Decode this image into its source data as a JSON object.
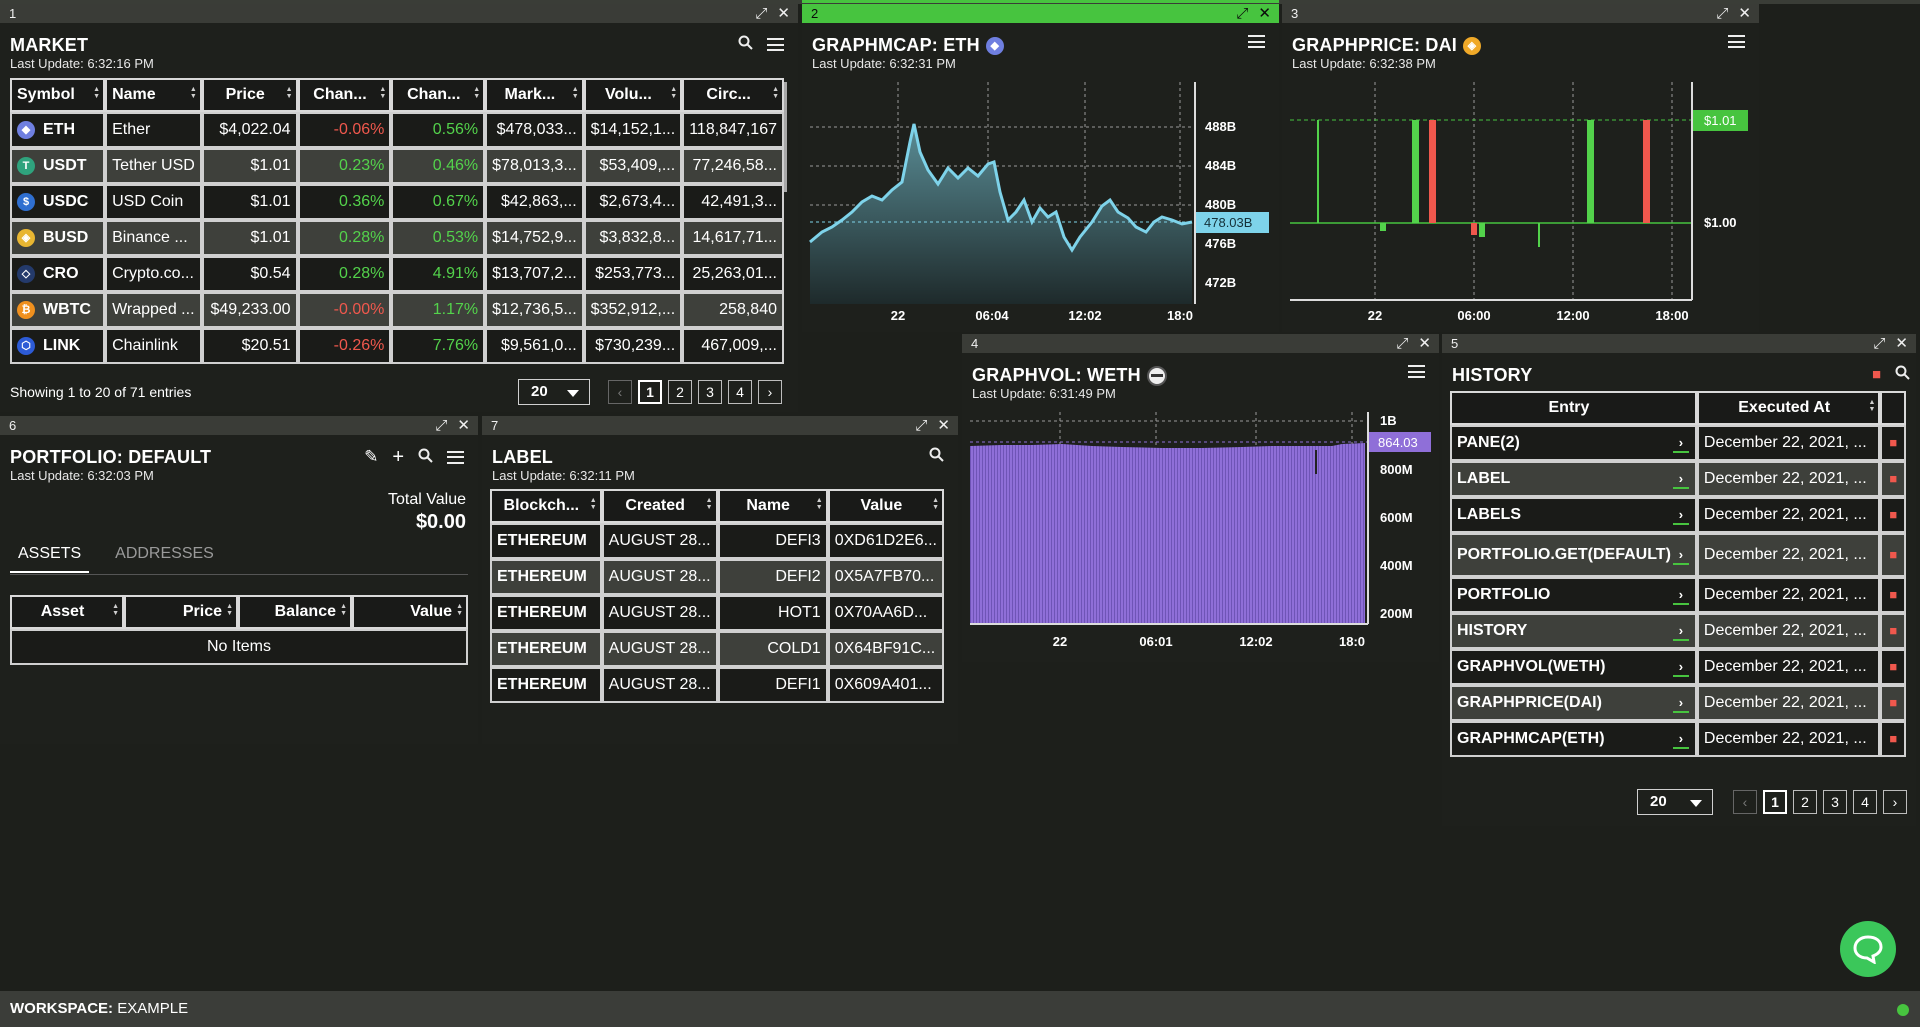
{
  "colors": {
    "accent": "#47c43f",
    "positive": "#53d24b",
    "negative": "#f0584d",
    "line": "#7ed3ea",
    "volume": "#8f6fd8"
  },
  "market": {
    "pane_num": "1",
    "title": "MARKET",
    "last_update": "Last Update: 6:32:16 PM",
    "columns": [
      "Symbol",
      "Name",
      "Price",
      "Chan...",
      "Chan...",
      "Mark...",
      "Volu...",
      "Circ..."
    ],
    "rows": [
      {
        "icon": "ethereum-coin-icon",
        "symbol": "ETH",
        "name": "Ether",
        "price": "$4,022.04",
        "c1": "-0.06%",
        "c2": "0.56%",
        "mcap": "$478,033...",
        "vol": "$14,152,1...",
        "circ": "118,847,167"
      },
      {
        "icon": "tether-coin-icon",
        "symbol": "USDT",
        "name": "Tether USD",
        "price": "$1.01",
        "c1": "0.23%",
        "c2": "0.46%",
        "mcap": "$78,013,3...",
        "vol": "$53,409,...",
        "circ": "77,246,58..."
      },
      {
        "icon": "usdc-coin-icon",
        "symbol": "USDC",
        "name": "USD Coin",
        "price": "$1.01",
        "c1": "0.36%",
        "c2": "0.67%",
        "mcap": "$42,863,...",
        "vol": "$2,673,4...",
        "circ": "42,491,3..."
      },
      {
        "icon": "binance-coin-icon",
        "symbol": "BUSD",
        "name": "Binance ...",
        "price": "$1.01",
        "c1": "0.28%",
        "c2": "0.53%",
        "mcap": "$14,752,9...",
        "vol": "$3,832,8...",
        "circ": "14,617,71..."
      },
      {
        "icon": "cronos-coin-icon",
        "symbol": "CRO",
        "name": "Crypto.co...",
        "price": "$0.54",
        "c1": "0.28%",
        "c2": "4.91%",
        "mcap": "$13,707,2...",
        "vol": "$253,773...",
        "circ": "25,263,01..."
      },
      {
        "icon": "bitcoin-coin-icon",
        "symbol": "WBTC",
        "name": "Wrapped ...",
        "price": "$49,233.00",
        "c1": "-0.00%",
        "c2": "1.17%",
        "mcap": "$12,736,5...",
        "vol": "$352,912,...",
        "circ": "258,840"
      },
      {
        "icon": "chainlink-coin-icon",
        "symbol": "LINK",
        "name": "Chainlink",
        "price": "$20.51",
        "c1": "-0.26%",
        "c2": "7.76%",
        "mcap": "$9,561,0...",
        "vol": "$730,239...",
        "circ": "467,009,..."
      }
    ],
    "showing": "Showing 1 to 20 of 71 entries",
    "page_size": "20",
    "pages": [
      "1",
      "2",
      "3",
      "4"
    ],
    "prev": "‹",
    "next": "›"
  },
  "graphmcap": {
    "pane_num": "2",
    "title": "GRAPHMCAP: ETH",
    "last_update": "Last Update: 6:32:31 PM",
    "current": "478.03B",
    "yticks": [
      "488B",
      "484B",
      "480B",
      "476B",
      "472B"
    ],
    "xticks": [
      "22",
      "06:04",
      "12:02",
      "18:0"
    ]
  },
  "graphprice": {
    "pane_num": "3",
    "title": "GRAPHPRICE: DAI",
    "last_update": "Last Update: 6:32:38 PM",
    "current": "$1.01",
    "yticks": [
      "$1.00"
    ],
    "xticks": [
      "22",
      "06:00",
      "12:00",
      "18:00"
    ]
  },
  "graphvol": {
    "pane_num": "4",
    "title": "GRAPHVOL: WETH",
    "last_update": "Last Update: 6:31:49 PM",
    "current": "864.03",
    "yticks": [
      "1B",
      "800M",
      "600M",
      "400M",
      "200M"
    ],
    "xticks": [
      "22",
      "06:01",
      "12:02",
      "18:0"
    ]
  },
  "history": {
    "pane_num": "5",
    "title": "HISTORY",
    "columns": [
      "Entry",
      "Executed At"
    ],
    "rows": [
      {
        "entry": "PANE(2)",
        "at": "December 22, 2021, ..."
      },
      {
        "entry": "LABEL",
        "at": "December 22, 2021, ..."
      },
      {
        "entry": "LABELS",
        "at": "December 22, 2021, ..."
      },
      {
        "entry": "PORTFOLIO.GET(DEFAULT)",
        "at": "December 22, 2021, ..."
      },
      {
        "entry": "PORTFOLIO",
        "at": "December 22, 2021, ..."
      },
      {
        "entry": "HISTORY",
        "at": "December 22, 2021, ..."
      },
      {
        "entry": "GRAPHVOL(WETH)",
        "at": "December 22, 2021, ..."
      },
      {
        "entry": "GRAPHPRICE(DAI)",
        "at": "December 22, 2021, ..."
      },
      {
        "entry": "GRAPHMCAP(ETH)",
        "at": "December 22, 2021, ..."
      }
    ],
    "page_size": "20",
    "pages": [
      "1",
      "2",
      "3",
      "4"
    ],
    "prev": "‹",
    "next": "›"
  },
  "portfolio": {
    "pane_num": "6",
    "title": "PORTFOLIO: DEFAULT",
    "last_update": "Last Update: 6:32:03 PM",
    "total_label": "Total Value",
    "total_value": "$0.00",
    "tabs": [
      "ASSETS",
      "ADDRESSES"
    ],
    "columns": [
      "Asset",
      "Price",
      "Balance",
      "Value"
    ],
    "empty": "No Items"
  },
  "label": {
    "pane_num": "7",
    "title": "LABEL",
    "last_update": "Last Update: 6:32:11 PM",
    "columns": [
      "Blockch...",
      "Created",
      "Name",
      "Value"
    ],
    "rows": [
      {
        "chain": "ETHEREUM",
        "created": "AUGUST 28...",
        "name": "DEFI3",
        "value": "0XD61D2E6..."
      },
      {
        "chain": "ETHEREUM",
        "created": "AUGUST 28...",
        "name": "DEFI2",
        "value": "0X5A7FB70..."
      },
      {
        "chain": "ETHEREUM",
        "created": "AUGUST 28...",
        "name": "HOT1",
        "value": "0X70AA6D..."
      },
      {
        "chain": "ETHEREUM",
        "created": "AUGUST 28...",
        "name": "COLD1",
        "value": "0X64BF91C..."
      },
      {
        "chain": "ETHEREUM",
        "created": "AUGUST 28...",
        "name": "DEFI1",
        "value": "0X609A401..."
      }
    ]
  },
  "workspace": {
    "label": "WORKSPACE:",
    "name": "EXAMPLE"
  }
}
